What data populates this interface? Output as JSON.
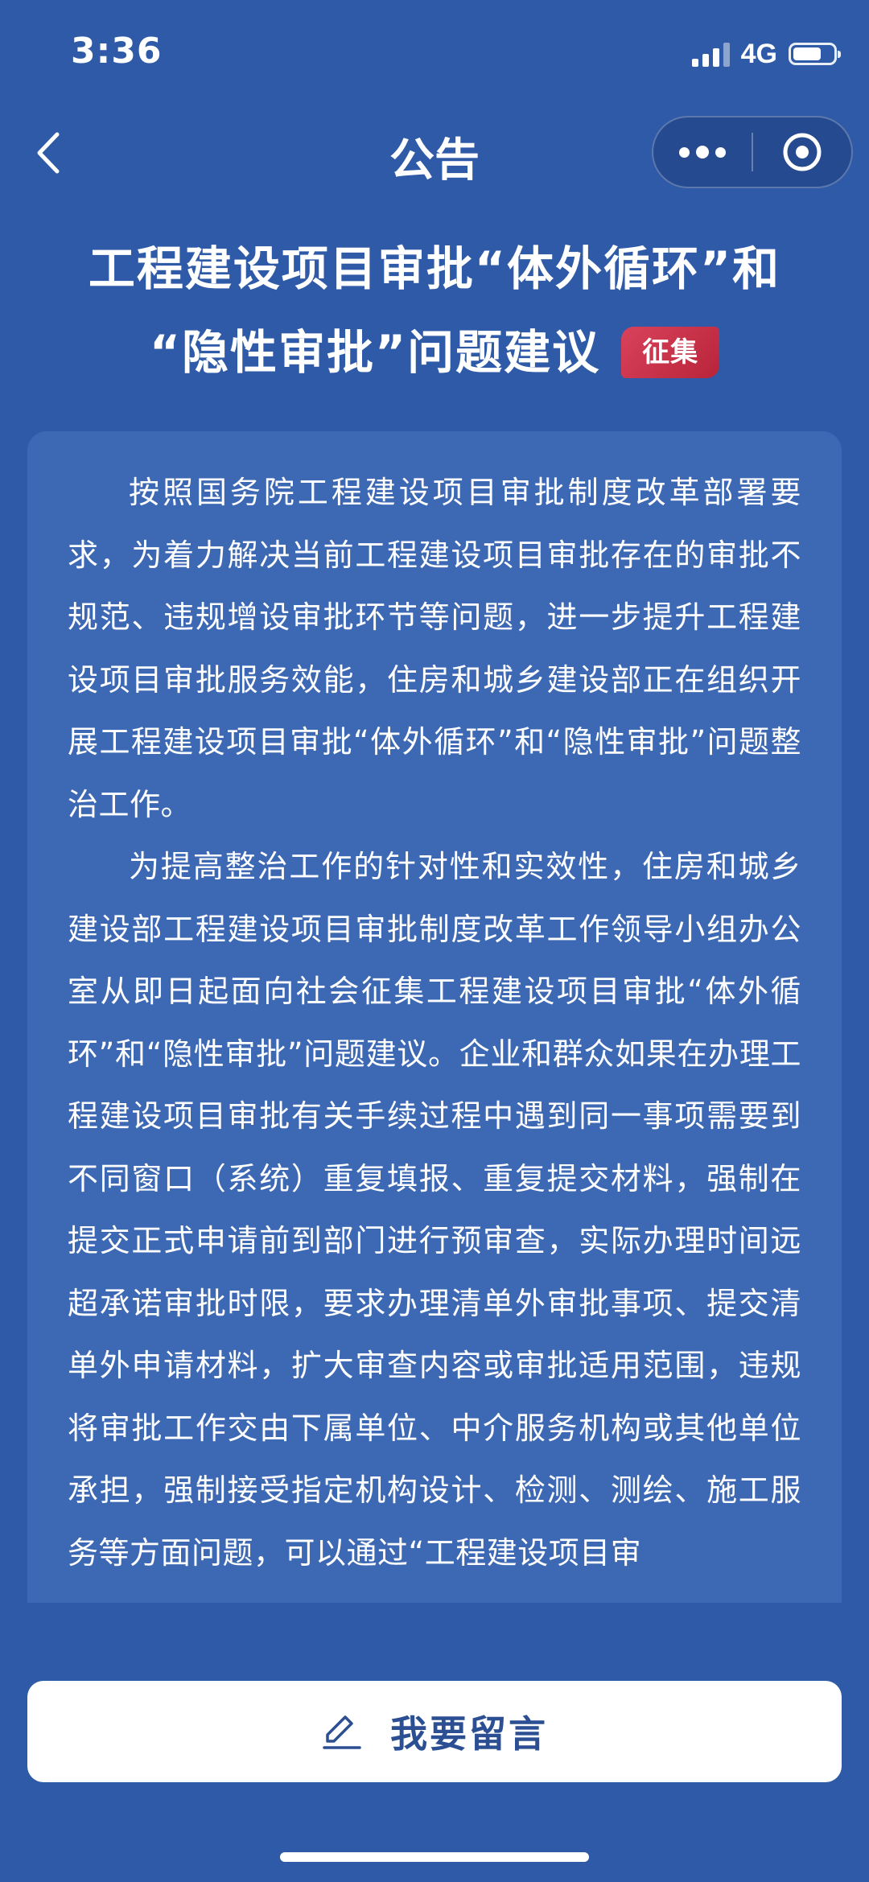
{
  "status_bar": {
    "time": "3:36",
    "network": "4G",
    "icons": [
      "signal-icon",
      "battery-icon"
    ]
  },
  "nav": {
    "title": "公告",
    "icons": [
      "back-icon",
      "more-icon",
      "target-icon"
    ]
  },
  "article": {
    "title_line1": "工程建设项目审批“体外循环”和",
    "title_line2": "“隐性审批”问题建议",
    "tag": "征集",
    "tag_color": "#c9304a",
    "paragraphs": [
      "按照国务院工程建设项目审批制度改革部署要求，为着力解决当前工程建设项目审批存在的审批不规范、违规增设审批环节等问题，进一步提升工程建设项目审批服务效能，住房和城乡建设部正在组织开展工程建设项目审批“体外循环”和“隐性审批”问题整治工作。",
      "为提高整治工作的针对性和实效性，住房和城乡建设部工程建设项目审批制度改革工作领导小组办公室从即日起面向社会征集工程建设项目审批“体外循环”和“隐性审批”问题建议。企业和群众如果在办理工程建设项目审批有关手续过程中遇到同一事项需要到不同窗口（系统）重复填报、重复提交材料，强制在提交正式申请前到部门进行预审查，实际办理时间远超承诺审批时限，要求办理清单外审批事项、提交清单外申请材料，扩大审查内容或审批适用范围，违规将审批工作交由下属单位、中介服务机构或其他单位承担，强制接受指定机构设计、检测、测绘、施工服务等方面问题，可以通过“工程建设项目审"
    ]
  },
  "comment_button": {
    "label": "我要留言",
    "icon": "edit-icon"
  },
  "colors": {
    "background": "#2f5aa7",
    "card": "#3d69b4",
    "button_text": "#2b4f92"
  }
}
